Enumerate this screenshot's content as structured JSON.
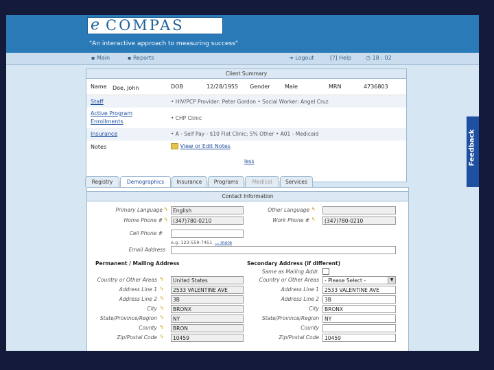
{
  "app": {
    "logo_text": "COMPAS",
    "logo_mark": "e",
    "tagline": "\"An interactive approach to measuring success\""
  },
  "nav": {
    "main": "Main",
    "reports": "Reports",
    "logout": "Logout",
    "help": "[?] Help",
    "timer": "18 : 02"
  },
  "client_summary": {
    "title": "Client Summary",
    "name_label": "Name",
    "name_value": "Doe, John",
    "dob_label": "DOB",
    "dob_value": "12/28/1955",
    "gender_label": "Gender",
    "gender_value": "Male",
    "mrn_label": "MRN",
    "mrn_value": "4736803",
    "staff_label": "Staff",
    "staff_value": "• HIV/PCP Provider: Peter Gordon   • Social Worker: Angel Cruz",
    "programs_label_1": "Active Program",
    "programs_label_2": "Enrollments",
    "programs_value": "• CHP Clinic",
    "insurance_label": "Insurance",
    "insurance_value": "• A - Self Pay - $10 Flat Clinic; 5% Other   • A01 - Medicaid",
    "notes_label": "Notes",
    "notes_link": "View or Edit Notes",
    "less_link": "less"
  },
  "tabs": [
    "Registry",
    "Demographics",
    "Insurance",
    "Programs",
    "Medical",
    "Services"
  ],
  "contact": {
    "title": "Contact Information",
    "primary_language_label": "Primary Language",
    "primary_language_value": "English",
    "other_language_label": "Other Language",
    "other_language_value": "",
    "home_phone_label": "Home Phone #",
    "home_phone_value": "(347)780-0210",
    "work_phone_label": "Work Phone #",
    "work_phone_value": "(347)780-0210",
    "cell_phone_label": "Cell Phone #",
    "cell_phone_value": "",
    "phone_hint": "e.g. 123-559-7451",
    "more_link": "... more",
    "email_label": "Email Address",
    "email_value": ""
  },
  "permanent_address": {
    "title": "Permanent / Mailing Address",
    "country_label": "Country or Other Areas",
    "country_value": "United States",
    "line1_label": "Address Line 1",
    "line1_value": "2533 VALENTINE AVE",
    "line2_label": "Address Line 2",
    "line2_value": "3B",
    "city_label": "City",
    "city_value": "BRONX",
    "state_label": "State/Province/Region",
    "state_value": "NY",
    "county_label": "County",
    "county_value": "BRON",
    "zip_label": "Zip/Postal Code",
    "zip_value": "10459"
  },
  "secondary_address": {
    "title": "Secondary Address (if different)",
    "same_label": "Same as Mailing Addr.",
    "country_label": "Country or Other Areas",
    "country_value": "- Please Select -",
    "line1_label": "Address Line 1",
    "line1_value": "2533 VALENTINE AVE",
    "line2_label": "Address Line 2",
    "line2_value": "3B",
    "city_label": "City",
    "city_value": "BRONX",
    "state_label": "State/Province/Region",
    "state_value": "NY",
    "county_label": "County",
    "county_value": "",
    "zip_label": "Zip/Postal Code",
    "zip_value": "10459"
  },
  "feedback_label": "Feedback",
  "colors": {
    "header": "#2a7ab8",
    "background": "#141b3a",
    "link": "#1f4fa0",
    "required_icon": "#c79a00"
  }
}
